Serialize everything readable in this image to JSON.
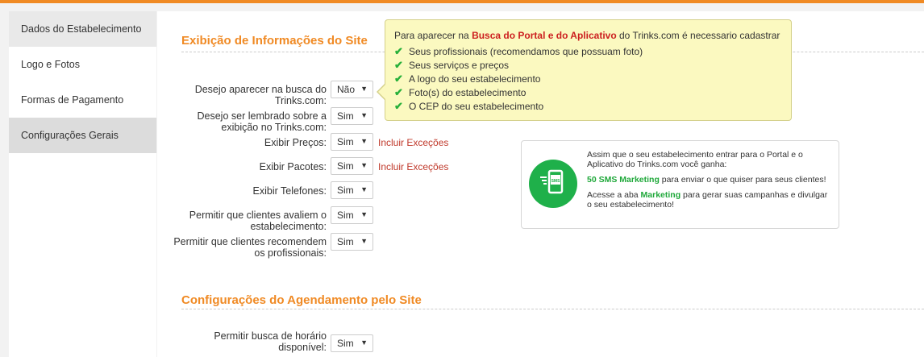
{
  "sidebar": {
    "items": [
      {
        "label": "Dados do Estabelecimento"
      },
      {
        "label": "Logo e Fotos"
      },
      {
        "label": "Formas de Pagamento"
      },
      {
        "label": "Configurações Gerais"
      }
    ]
  },
  "sections": {
    "site_title": "Exibição de Informações do Site",
    "agenda_title": "Configurações do Agendamento pelo Site"
  },
  "form": {
    "rows": [
      {
        "label": "Desejo aparecer na busca do Trinks.com:",
        "value": "Não"
      },
      {
        "label": "Desejo ser lembrado sobre a exibição no Trinks.com:",
        "value": "Sim"
      },
      {
        "label": "Exibir Preços:",
        "value": "Sim",
        "link": "Incluir Exceções"
      },
      {
        "label": "Exibir Pacotes:",
        "value": "Sim",
        "link": "Incluir Exceções"
      },
      {
        "label": "Exibir Telefones:",
        "value": "Sim"
      },
      {
        "label": "Permitir que clientes avaliem o estabelecimento:",
        "value": "Sim"
      },
      {
        "label": "Permitir que clientes recomendem os profissionais:",
        "value": "Sim"
      },
      {
        "label": "Permitir busca de horário disponível:",
        "value": "Sim"
      }
    ]
  },
  "tooltip": {
    "intro_before": "Para aparecer na ",
    "intro_highlight": "Busca do Portal e do Aplicativo",
    "intro_after": " do Trinks.com é necessario cadastrar",
    "items": [
      "Seus profissionais (recomendamos que possuam foto)",
      "Seus serviços e preços",
      "A logo do seu estabelecimento",
      "Foto(s) do estabelecimento",
      "O CEP do seu estabelecimento"
    ]
  },
  "sms": {
    "icon_text": "SMS",
    "p1": "Assim que o seu estabelecimento entrar para o Portal e o Aplicativo do Trinks.com você ganha:",
    "p2_highlight": "50 SMS Marketing",
    "p2_rest": " para enviar o que quiser para seus clientes!",
    "p3_before": "Acesse a aba ",
    "p3_highlight": "Marketing",
    "p3_after": " para gerar suas campanhas e divulgar o seu estabelecimento!"
  },
  "colors": {
    "accent": "#f08a24",
    "link": "#c0392b",
    "green": "#1fb04a"
  }
}
